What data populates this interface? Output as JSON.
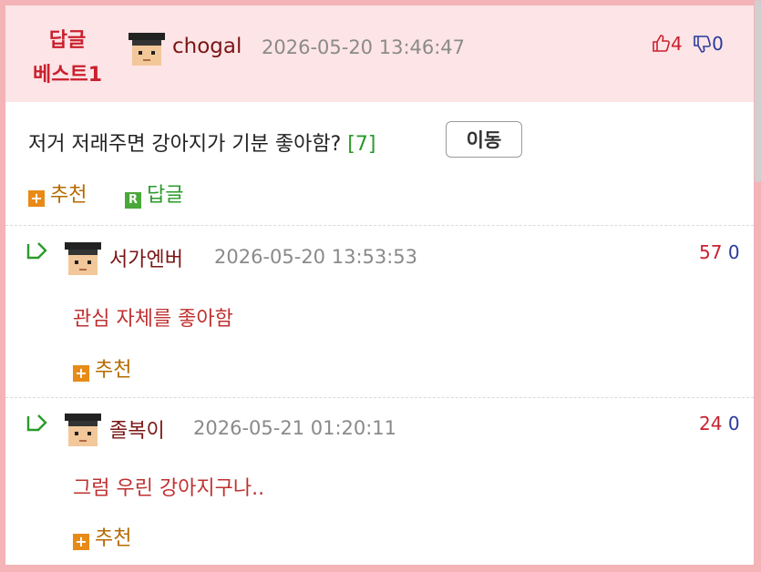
{
  "best": {
    "badge_line1": "답글",
    "badge_line2": "베스트1",
    "user": "chogal",
    "date": "2026-05-20 13:46:47",
    "up": "4",
    "down": "0",
    "text": "저거 저래주면 강아지가 기분 좋아함?",
    "reply_count": "[7]",
    "move_label": "이동",
    "recommend_label": "추천",
    "reply_label": "답글",
    "recommend_icon": "+",
    "reply_icon": "R"
  },
  "replies": [
    {
      "user": "서가엔버",
      "date": "2026-05-20 13:53:53",
      "up": "57",
      "down": "0",
      "text": "관심 자체를 좋아함",
      "recommend_label": "추천",
      "recommend_icon": "+"
    },
    {
      "user": "졸복이",
      "date": "2026-05-21 01:20:11",
      "up": "24",
      "down": "0",
      "text": "그럼 우린 강아지구나..",
      "recommend_label": "추천",
      "recommend_icon": "+"
    }
  ],
  "colors": {
    "frame": "#f4b3b6",
    "header_bg": "#fde4e6",
    "accent_red": "#c9202e",
    "accent_blue": "#2b3a9e",
    "reply_green": "#2a9a2a",
    "action_orange": "#e88a17"
  },
  "icons": {
    "thumbs_up": "thumbs-up-icon",
    "thumbs_down": "thumbs-down-icon",
    "reply_arrow": "reply-arrow-icon",
    "avatar": "pixel-avatar-icon"
  }
}
